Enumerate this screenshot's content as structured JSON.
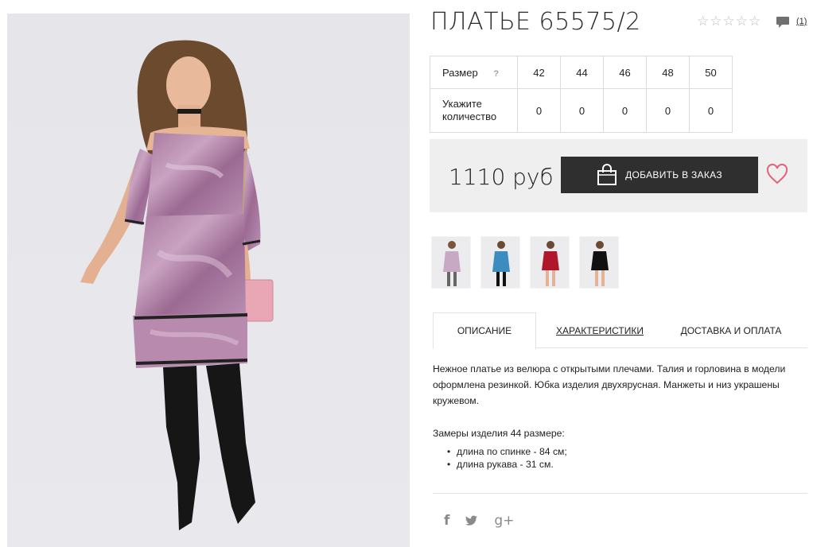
{
  "product": {
    "title": "ПЛАТЬЕ 65575/2",
    "rating_stars": 5,
    "review_count": "(1)"
  },
  "size_table": {
    "size_label": "Размер",
    "help": "?",
    "qty_label_line1": "Укажите",
    "qty_label_line2": "количество",
    "sizes": [
      "42",
      "44",
      "46",
      "48",
      "50"
    ],
    "quantities": [
      "0",
      "0",
      "0",
      "0",
      "0"
    ]
  },
  "purchase": {
    "price": "1110 руб",
    "add_to_order_label": "ДОБАВИТЬ В ЗАКАЗ",
    "accent_color": "#e2627b",
    "button_color": "#2f2f2f"
  },
  "thumbnails": [
    {
      "color": "#c8a9c4"
    },
    {
      "color": "#3c8cc0"
    },
    {
      "color": "#b0162c"
    },
    {
      "color": "#111111"
    }
  ],
  "tabs": {
    "description": "ОПИСАНИЕ",
    "specs": "ХАРАКТЕРИСТИКИ",
    "delivery": "ДОСТАВКА И ОПЛАТА"
  },
  "description": {
    "text": "Нежное платье из велюра с открытыми плечами. Талия и горловина в модели оформлена резинкой. Юбка изделия двухярусная. Манжеты и низ украшены кружевом.",
    "measures_title": "Замеры изделия 44 размере:",
    "measures": [
      "длина по спинке - 84 см;",
      "длина рукава - 31 см."
    ]
  },
  "social": {
    "facebook": "f",
    "twitter": "❦",
    "google": "g+"
  }
}
